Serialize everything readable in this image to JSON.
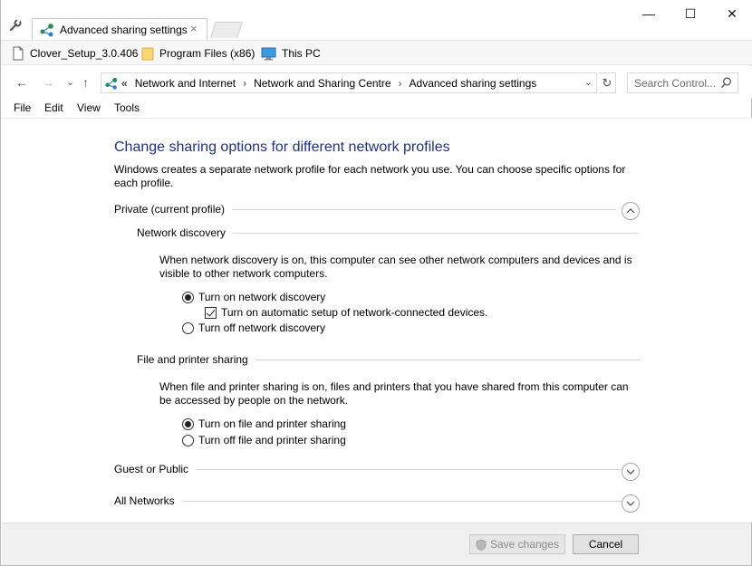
{
  "window": {
    "tab_title": "Advanced sharing settings",
    "tab_close": "×",
    "minimize": "—",
    "maximize": "☐",
    "close": "✕"
  },
  "favorites": [
    {
      "label": "Clover_Setup_3.0.406",
      "icon": "file-icon"
    },
    {
      "label": "Program Files (x86)",
      "icon": "folder-icon"
    },
    {
      "label": "This PC",
      "icon": "computer-icon"
    }
  ],
  "navigation": {
    "back": "←",
    "forward": "→",
    "recent": "⌄",
    "up": "↑",
    "overflow": "«",
    "breadcrumbs": [
      "Network and Internet",
      "Network and Sharing Centre",
      "Advanced sharing settings"
    ],
    "separator": "›",
    "dropdown": "⌄",
    "refresh": "↻",
    "search_placeholder": "Search Control..."
  },
  "menu": [
    "File",
    "Edit",
    "View",
    "Tools"
  ],
  "content": {
    "heading": "Change sharing options for different network profiles",
    "intro": "Windows creates a separate network profile for each network you use. You can choose specific options for each profile.",
    "private_profile": "Private (current profile)",
    "network_discovery": {
      "title": "Network discovery",
      "description": "When network discovery is on, this computer can see other network computers and devices and is visible to other network computers.",
      "on_label": "Turn on network discovery",
      "auto_setup_label": "Turn on automatic setup of network-connected devices.",
      "off_label": "Turn off network discovery"
    },
    "file_sharing": {
      "title": "File and printer sharing",
      "description": "When file and printer sharing is on, files and printers that you have shared from this computer can be accessed by people on the network.",
      "on_label": "Turn on file and printer sharing",
      "off_label": "Turn off file and printer sharing"
    },
    "guest_profile": "Guest or Public",
    "all_networks": "All Networks"
  },
  "footer": {
    "save_label": "Save changes",
    "cancel_label": "Cancel"
  },
  "colors": {
    "heading": "#1e3287",
    "accent": "#0078d7"
  }
}
